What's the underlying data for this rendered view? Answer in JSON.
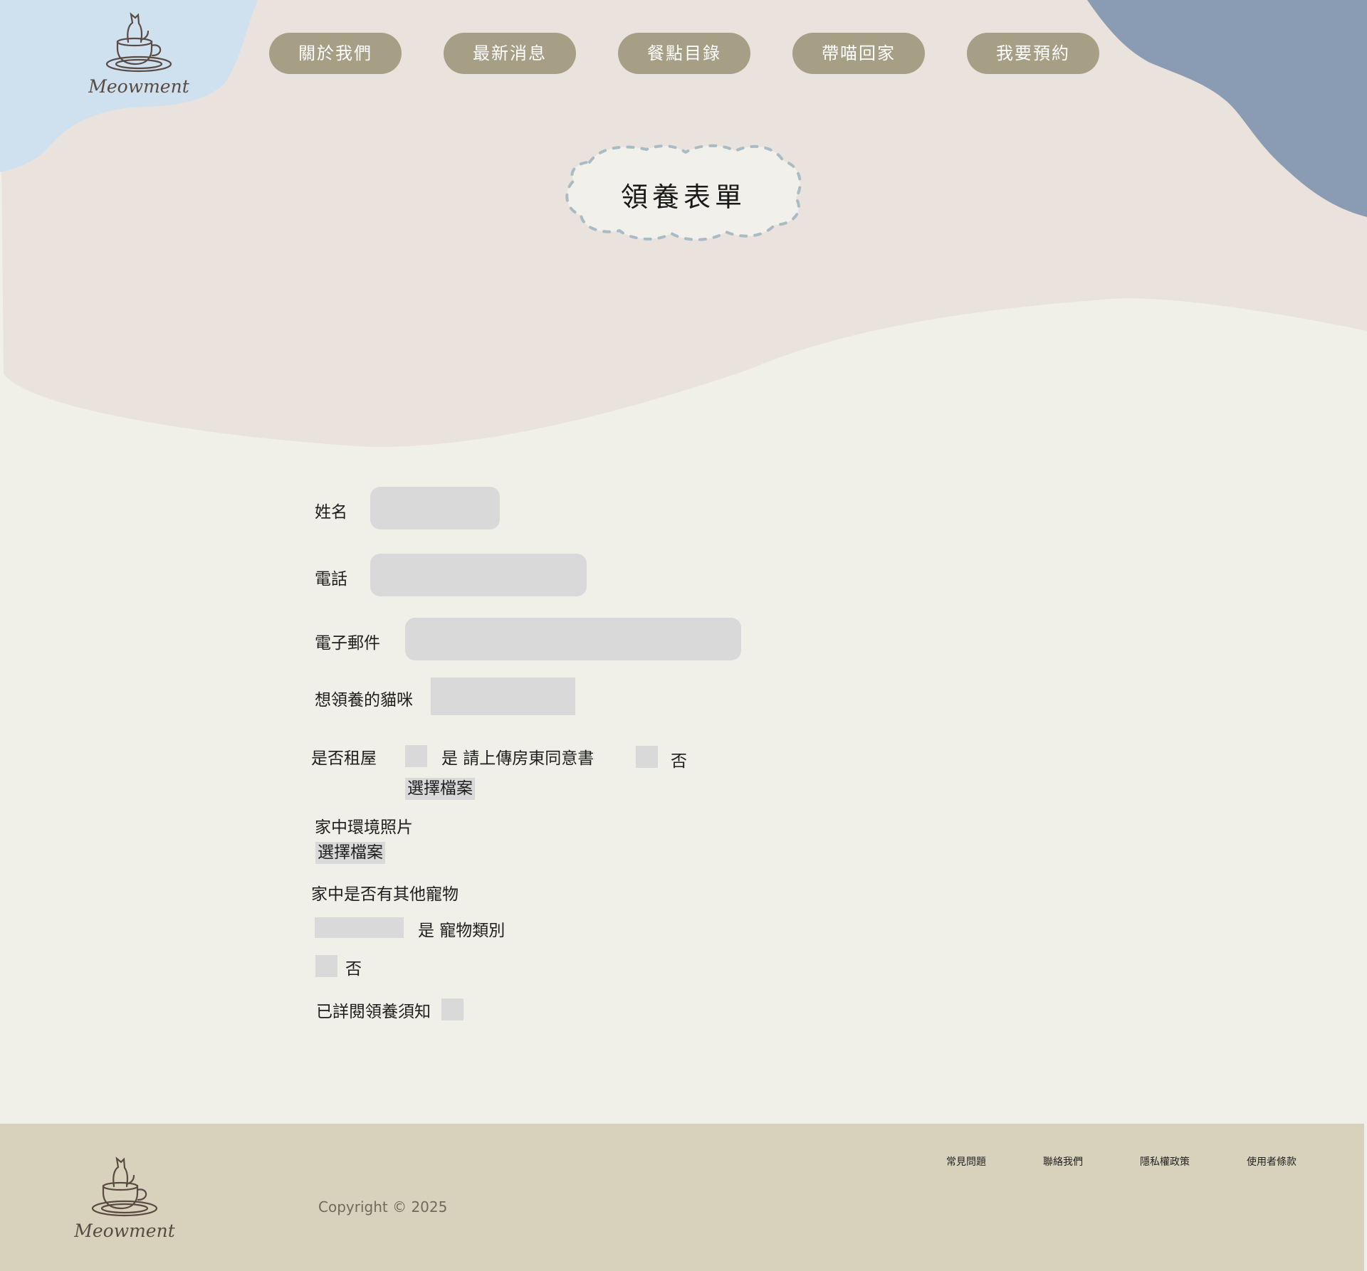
{
  "brand": {
    "name": "Meowment"
  },
  "nav": {
    "items": [
      {
        "label": "關於我們"
      },
      {
        "label": "最新消息"
      },
      {
        "label": "餐點目錄"
      },
      {
        "label": "帶喵回家"
      },
      {
        "label": "我要預約"
      }
    ]
  },
  "page": {
    "title": "領養表單"
  },
  "form": {
    "name_label": "姓名",
    "phone_label": "電話",
    "email_label": "電子郵件",
    "cat_label": "想領養的貓咪",
    "rent_label": "是否租屋",
    "rent_yes_label": "是 請上傳房東同意書",
    "rent_no_label": "否",
    "file_button_label": "選擇檔案",
    "env_photo_label": "家中環境照片",
    "env_file_button_label": "選擇檔案",
    "pets_label": "家中是否有其他寵物",
    "pets_yes_label": "是 寵物類別",
    "pets_no_label": "否",
    "read_label": "已詳閱領養須知"
  },
  "footer": {
    "copyright": "Copyright © 2025",
    "links": [
      {
        "label": "常見問題"
      },
      {
        "label": "聯絡我們"
      },
      {
        "label": "隱私權政策"
      },
      {
        "label": "使用者條款"
      }
    ]
  },
  "colors": {
    "page_bg": "#f0efe8",
    "header_blush": "#e9e2dd",
    "sky_blue": "#cfe0ee",
    "slate_blue": "#8a9cb3",
    "nav_button": "#a69f85",
    "input_gray": "#d9d9d9",
    "footer_bg": "#d8d2bc",
    "title_dash": "#a9bcc4"
  },
  "icons": {
    "logo": "cat-in-teacup-icon"
  }
}
